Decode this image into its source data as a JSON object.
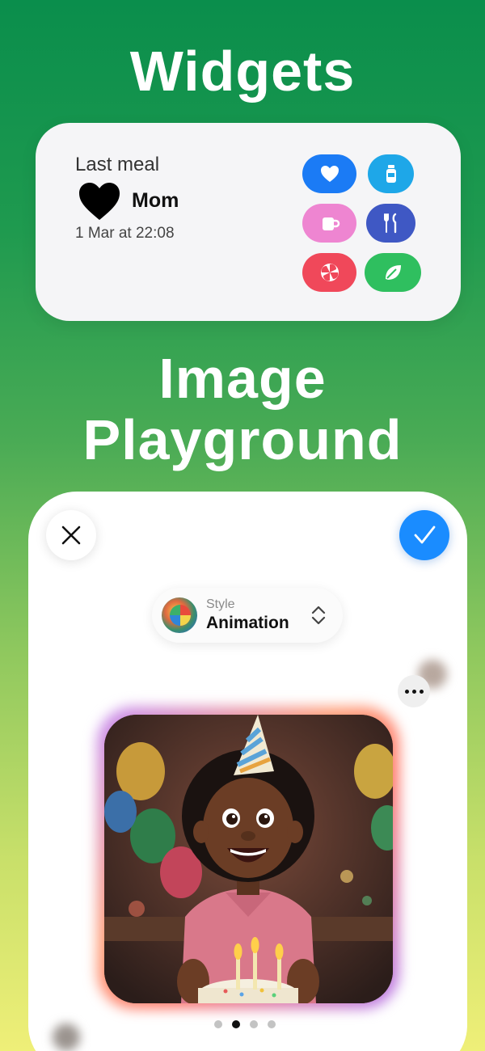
{
  "hero": {
    "title_widgets": "Widgets",
    "title_playground_line1": "Image",
    "title_playground_line2": "Playground"
  },
  "widget": {
    "label": "Last meal",
    "name": "Mom",
    "time": "1 Mar at 22:08",
    "quick_actions": [
      {
        "icon": "heart-icon",
        "color": "#1b7bf5"
      },
      {
        "icon": "bottle-icon",
        "color": "#1ea7e8"
      },
      {
        "icon": "cup-icon",
        "color": "#ee85d1"
      },
      {
        "icon": "fork-knife-icon",
        "color": "#3f58c4"
      },
      {
        "icon": "pinwheel-icon",
        "color": "#f0485a"
      },
      {
        "icon": "leaf-icon",
        "color": "#2fbf5f"
      }
    ]
  },
  "playground": {
    "style_label": "Style",
    "style_value": "Animation",
    "page_count": 4,
    "active_page": 1,
    "accent": "#1a8cff"
  }
}
